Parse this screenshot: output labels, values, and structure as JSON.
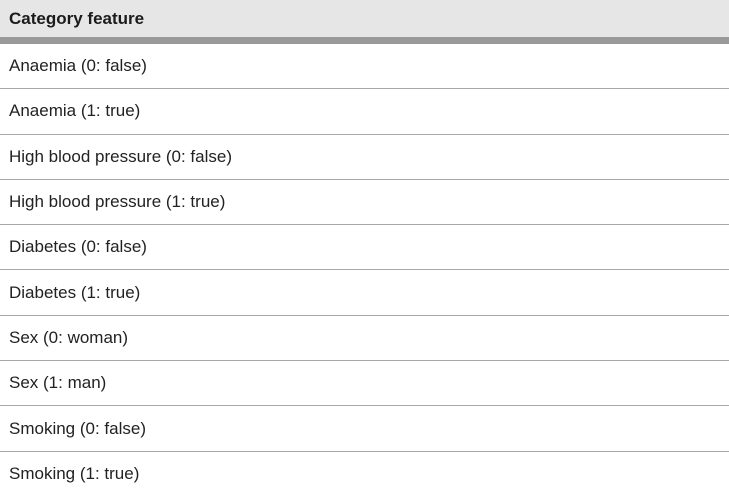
{
  "table": {
    "header": "Category feature",
    "rows": [
      "Anaemia (0: false)",
      "Anaemia (1: true)",
      "High blood pressure (0: false)",
      "High blood pressure (1: true)",
      "Diabetes (0: false)",
      "Diabetes (1: true)",
      "Sex (0: woman)",
      "Sex (1: man)",
      "Smoking (0: false)",
      "Smoking (1: true)"
    ]
  }
}
